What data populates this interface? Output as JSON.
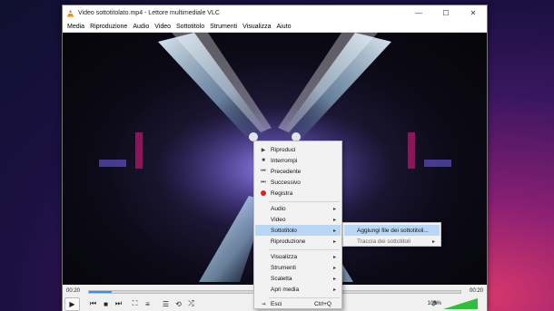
{
  "window": {
    "title": "Video sottotitolato.mp4 - Lettore multimediale VLC",
    "buttons": {
      "minimize": "—",
      "maximize": "☐",
      "close": "✕"
    }
  },
  "menubar": [
    "Media",
    "Riproduzione",
    "Audio",
    "Video",
    "Sottotitolo",
    "Strumenti",
    "Visualizza",
    "Aiuto"
  ],
  "player": {
    "elapsed": "00:20",
    "duration": "00:20",
    "progress": 0.06,
    "volume": "100%",
    "volume_level": 1.0
  },
  "context_menu": {
    "items": [
      {
        "label": "Riproduci",
        "icon": "play-icon"
      },
      {
        "label": "Interrompi",
        "icon": "stop-icon"
      },
      {
        "label": "Precedente",
        "icon": "previous-icon"
      },
      {
        "label": "Successivo",
        "icon": "next-icon"
      },
      {
        "label": "Registra",
        "icon": "record-icon"
      },
      {
        "label": "Audio",
        "submenu": true
      },
      {
        "label": "Video",
        "submenu": true
      },
      {
        "label": "Sottotitolo",
        "submenu": true,
        "highlighted": true
      },
      {
        "label": "Riproduzione",
        "submenu": true
      },
      {
        "label": "Visualizza",
        "submenu": true
      },
      {
        "label": "Strumenti",
        "submenu": true
      },
      {
        "label": "Scaletta",
        "submenu": true
      },
      {
        "label": "Apri media",
        "submenu": true
      },
      {
        "label": "Esci",
        "shortcut": "Ctrl+Q",
        "icon": "exit-icon"
      }
    ]
  },
  "submenu": {
    "items": [
      {
        "label": "Aggiungi file dei sottotitoli...",
        "highlighted": true
      },
      {
        "label": "Traccia dei sottotitoli",
        "submenu": true
      }
    ]
  },
  "colors": {
    "accent": "#3a8ee6",
    "highlight": "#b9d7f5",
    "record": "#e02020",
    "vlc_orange": "#f08a00"
  }
}
